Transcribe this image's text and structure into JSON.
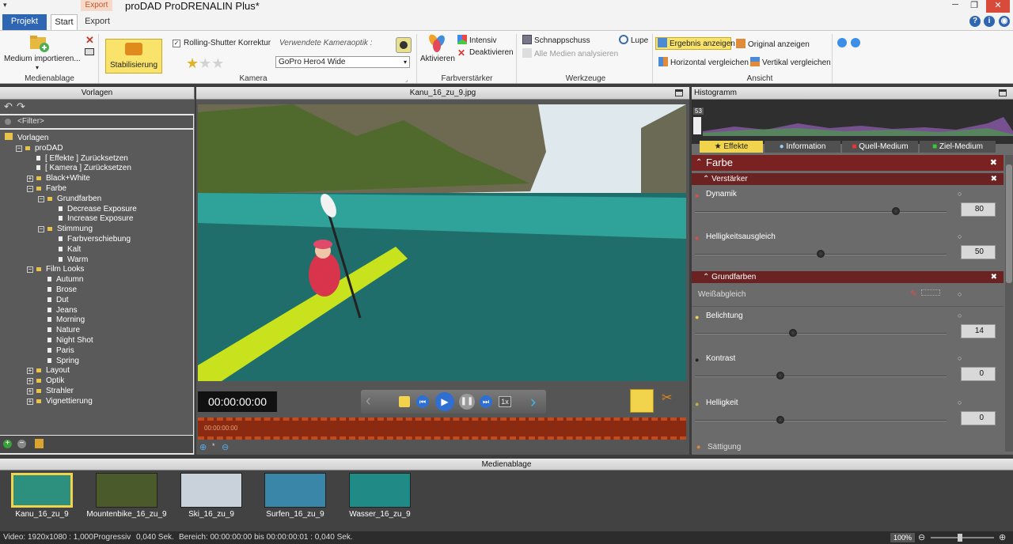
{
  "window": {
    "title": "proDAD ProDRENALIN Plus*",
    "menu_arrow": "▾"
  },
  "tabs": {
    "projekt": "Projekt",
    "start": "Start",
    "export": "Export",
    "export_context": "Export"
  },
  "ribbon": {
    "medium_importieren": "Medium importieren...",
    "medienablage_label": "Medienablage",
    "stabilisierung": "Stabilisierung",
    "rolling_shutter": "Rolling-Shutter Korrektur",
    "kameraoptik_label": "Verwendete Kameraoptik :",
    "kameraoptik_value": "GoPro Hero4 Wide",
    "kamera_label": "Kamera",
    "aktivieren": "Aktivieren",
    "intensiv": "Intensiv",
    "deaktivieren": "Deaktivieren",
    "farbverstaerker_label": "Farbverstärker",
    "schnappschuss": "Schnappschuss",
    "lupe": "Lupe",
    "alle_medien": "Alle Medien analysieren",
    "werkzeuge_label": "Werkzeuge",
    "ergebnis_anzeigen": "Ergebnis anzeigen",
    "original_anzeigen": "Original anzeigen",
    "horizontal_vergleichen": "Horizontal vergleichen",
    "vertikal_vergleichen": "Vertikal vergleichen",
    "ansicht_label": "Ansicht",
    "rating_stars": 1
  },
  "left_panel": {
    "title": "Vorlagen",
    "filter": "<Filter>",
    "tree": [
      {
        "label": "Vorlagen",
        "level": 0,
        "kind": "root"
      },
      {
        "label": "proDAD",
        "level": 1,
        "kind": "folder",
        "exp": "−"
      },
      {
        "label": "[ Effekte ]  Zurücksetzen",
        "level": 2,
        "kind": "doc"
      },
      {
        "label": "[ Kamera ]  Zurücksetzen",
        "level": 2,
        "kind": "doc"
      },
      {
        "label": "Black+White",
        "level": 2,
        "kind": "folder",
        "exp": "+"
      },
      {
        "label": "Farbe",
        "level": 2,
        "kind": "folder",
        "exp": "−"
      },
      {
        "label": "Grundfarben",
        "level": 3,
        "kind": "folder",
        "exp": "−"
      },
      {
        "label": "Decrease Exposure",
        "level": 4,
        "kind": "doc"
      },
      {
        "label": "Increase Exposure",
        "level": 4,
        "kind": "doc"
      },
      {
        "label": "Stimmung",
        "level": 3,
        "kind": "folder",
        "exp": "−"
      },
      {
        "label": "Farbverschiebung",
        "level": 4,
        "kind": "doc"
      },
      {
        "label": "Kalt",
        "level": 4,
        "kind": "doc"
      },
      {
        "label": "Warm",
        "level": 4,
        "kind": "doc"
      },
      {
        "label": "Film Looks",
        "level": 2,
        "kind": "folder",
        "exp": "−"
      },
      {
        "label": "Autumn",
        "level": 3,
        "kind": "doc"
      },
      {
        "label": "Brose",
        "level": 3,
        "kind": "doc"
      },
      {
        "label": "Dut",
        "level": 3,
        "kind": "doc"
      },
      {
        "label": "Jeans",
        "level": 3,
        "kind": "doc"
      },
      {
        "label": "Morning",
        "level": 3,
        "kind": "doc"
      },
      {
        "label": "Nature",
        "level": 3,
        "kind": "doc"
      },
      {
        "label": "Night Shot",
        "level": 3,
        "kind": "doc"
      },
      {
        "label": "Paris",
        "level": 3,
        "kind": "doc"
      },
      {
        "label": "Spring",
        "level": 3,
        "kind": "doc"
      },
      {
        "label": "Layout",
        "level": 2,
        "kind": "folder",
        "exp": "+"
      },
      {
        "label": "Optik",
        "level": 2,
        "kind": "folder",
        "exp": "+"
      },
      {
        "label": "Strahler",
        "level": 2,
        "kind": "folder",
        "exp": "+"
      },
      {
        "label": "Vignettierung",
        "level": 2,
        "kind": "folder",
        "exp": "+"
      }
    ]
  },
  "center": {
    "filename": "Kanu_16_zu_9.jpg",
    "timecode": "00:00:00:00",
    "speed": "1x",
    "timeline_time": "00:00:00:00"
  },
  "right_panel": {
    "histogram_title": "Histogramm",
    "histogram_value": "53",
    "tabs": {
      "effekte": "Effekte",
      "information": "Information",
      "quell": "Quell-Medium",
      "ziel": "Ziel-Medium"
    },
    "section_farbe": "Farbe",
    "sub_verstaerker": "Verstärker",
    "sub_grundfarben": "Grundfarben",
    "dynamik": {
      "label": "Dynamik",
      "value": "80",
      "level": 0.8
    },
    "helligkeitsausgleich": {
      "label": "Helligkeitsausgleich",
      "value": "50",
      "level": 0.5
    },
    "weissabgleich": "Weißabgleich",
    "belichtung": {
      "label": "Belichtung",
      "value": "14",
      "level": 0.39
    },
    "kontrast": {
      "label": "Kontrast",
      "value": "0",
      "level": 0.34
    },
    "helligkeit": {
      "label": "Helligkeit",
      "value": "0",
      "level": 0.34
    },
    "saettigung": "Sättigung"
  },
  "media": {
    "title": "Medienablage",
    "items": [
      {
        "label": "Kanu_16_zu_9",
        "color": "#2d8f7e",
        "selected": true
      },
      {
        "label": "Mountenbike_16_zu_9",
        "color": "#4a5a2a",
        "selected": false
      },
      {
        "label": "Ski_16_zu_9",
        "color": "#c9d2da",
        "selected": false
      },
      {
        "label": "Surfen_16_zu_9",
        "color": "#3a86a9",
        "selected": false
      },
      {
        "label": "Wasser_16_zu_9",
        "color": "#1f8a86",
        "selected": false
      }
    ]
  },
  "status": {
    "video": "Video: 1920x1080 : 1,000",
    "progressiv": "Progressiv",
    "duration": "0,040 Sek.",
    "bereich": "Bereich: 00:00:00:00 bis 00:00:00:01 : 0,040 Sek.",
    "zoom": "100%"
  }
}
